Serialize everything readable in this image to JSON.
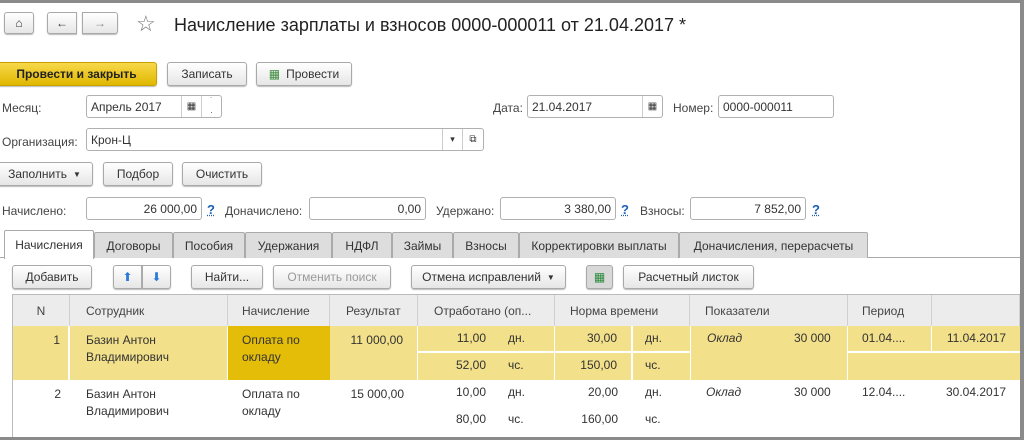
{
  "title": "Начисление зарплаты и взносов 0000-000011 от 21.04.2017 *",
  "toolbar": {
    "post_close": "Провести и закрыть",
    "save": "Записать",
    "post": "Провести"
  },
  "fields": {
    "month_label": "Месяц:",
    "month_value": "Апрель 2017",
    "date_label": "Дата:",
    "date_value": "21.04.2017",
    "number_label": "Номер:",
    "number_value": "0000-000011",
    "org_label": "Организация:",
    "org_value": "Крон-Ц"
  },
  "actions": {
    "fill": "Заполнить",
    "select": "Подбор",
    "clear": "Очистить"
  },
  "totals": {
    "accrued_label": "Начислено:",
    "accrued": "26 000,00",
    "extra_label": "Доначислено:",
    "extra": "0,00",
    "withheld_label": "Удержано:",
    "withheld": "3 380,00",
    "contrib_label": "Взносы:",
    "contrib": "7 852,00",
    "help": "?"
  },
  "tabs": [
    "Начисления",
    "Договоры",
    "Пособия",
    "Удержания",
    "НДФЛ",
    "Займы",
    "Взносы",
    "Корректировки выплаты",
    "Доначисления, перерасчеты"
  ],
  "table_toolbar": {
    "add": "Добавить",
    "find": "Найти...",
    "cancel_search": "Отменить поиск",
    "undo_fix": "Отмена исправлений",
    "payslip": "Расчетный листок"
  },
  "columns": [
    "N",
    "Сотрудник",
    "Начисление",
    "Результат",
    "Отработано (оп...",
    "Норма времени",
    "Показатели",
    "Период"
  ],
  "rows": [
    {
      "n": "1",
      "employee": "Базин Антон Владимирович",
      "accrual": "Оплата по окладу",
      "result": "11 000,00",
      "worked_days": "11,00",
      "unit_days": "дн.",
      "worked_hours": "52,00",
      "unit_hours": "чс.",
      "norm_days": "30,00",
      "norm_unit_days": "дн.",
      "norm_hours": "150,00",
      "norm_unit_hours": "чс.",
      "indicator": "Оклад",
      "indicator_value": "30 000",
      "period_from": "01.04....",
      "period_to": "11.04.2017"
    },
    {
      "n": "2",
      "employee": "Базин Антон Владимирович",
      "accrual": "Оплата по окладу",
      "result": "15 000,00",
      "worked_days": "10,00",
      "unit_days": "дн.",
      "worked_hours": "80,00",
      "unit_hours": "чс.",
      "norm_days": "20,00",
      "norm_unit_days": "дн.",
      "norm_hours": "160,00",
      "norm_unit_hours": "чс.",
      "indicator": "Оклад",
      "indicator_value": "30 000",
      "period_from": "12.04....",
      "period_to": "30.04.2017"
    }
  ]
}
